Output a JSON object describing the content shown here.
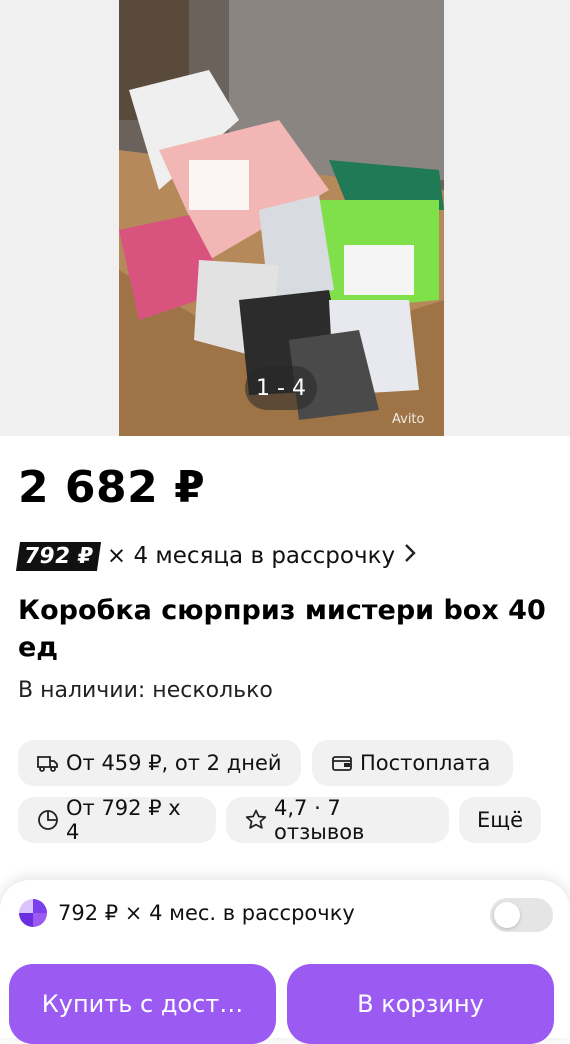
{
  "gallery": {
    "counter": "1 - 4",
    "watermark": "Avito"
  },
  "product": {
    "price": "2 682 ₽",
    "installment_badge": "792 ₽",
    "installment_text": "× 4 месяца в рассрочку",
    "title": "Коробка сюрприз мистери box 40 ед",
    "stock": "В наличии: несколько"
  },
  "chips": [
    {
      "label": "От 459 ₽, от 2 дней",
      "icon": "truck-icon"
    },
    {
      "label": "Постоплата",
      "icon": "wallet-icon"
    },
    {
      "label": "От 792 ₽ x 4",
      "icon": "pie-chart-icon"
    },
    {
      "label": "4,7 · 7 отзывов",
      "icon": "star-icon"
    },
    {
      "label": "Ещё",
      "icon": ""
    }
  ],
  "bottom": {
    "installment_text": "792 ₽ × 4 мес. в рассрочку",
    "installment_toggle_on": false,
    "buy_button": "Купить с дост…",
    "cart_button": "В корзину"
  },
  "colors": {
    "accent": "#9b5af2",
    "chip_bg": "#f1f1f1",
    "badge_bg": "#111111"
  }
}
